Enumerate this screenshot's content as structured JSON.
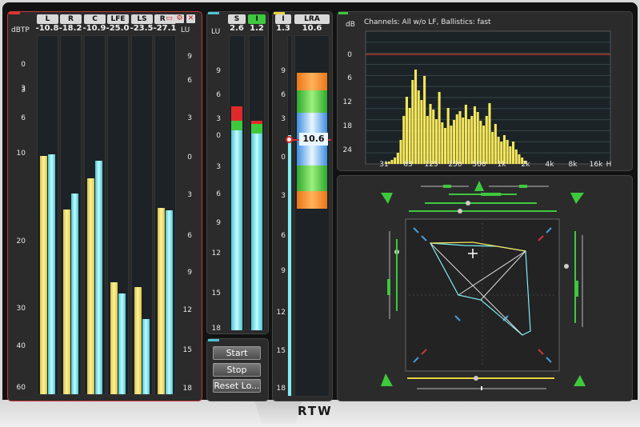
{
  "loudness_panel": {
    "channels": [
      {
        "label": "L",
        "value": "-10.8"
      },
      {
        "label": "R",
        "value": "-18.2"
      },
      {
        "label": "C",
        "value": "-10.9"
      },
      {
        "label": "LFE",
        "value": "-25.0"
      },
      {
        "label": "LS",
        "value": "-23.5"
      },
      {
        "label": "RS",
        "value": "-27.1"
      }
    ],
    "left_unit": "dBTP",
    "right_unit": "LU",
    "left_ticks": [
      "3",
      "0",
      "3",
      "6",
      "10",
      "20",
      "30",
      "40",
      "60"
    ],
    "right_ticks": [
      "9",
      "6",
      "3",
      "0",
      "3",
      "6",
      "9",
      "12",
      "15",
      "18"
    ],
    "icons": {
      "window": "window-icon",
      "settings": "settings-icon",
      "close": "close-icon"
    },
    "close_glyph": "✕"
  },
  "si_panel": {
    "headers": [
      {
        "label": "S",
        "value": "2.6"
      },
      {
        "label": "I",
        "value": "1.2"
      }
    ],
    "unit": "LU",
    "ticks": [
      "9",
      "6",
      "3",
      "0",
      "3",
      "6",
      "9",
      "12",
      "15",
      "18"
    ]
  },
  "controls": {
    "start": "Start",
    "stop": "Stop",
    "reset": "Reset Lo..."
  },
  "lra_panel": {
    "headers": [
      {
        "label": "I",
        "value": "1.3"
      },
      {
        "label": "LRA",
        "value": "10.6"
      }
    ],
    "marker_value": "10.6",
    "ticks": [
      "9",
      "6",
      "3",
      "0",
      "3",
      "6",
      "9",
      "12",
      "15",
      "18"
    ]
  },
  "spectrum_panel": {
    "title": "Channels: All w/o LF, Ballistics: fast",
    "y_unit": "dB",
    "y_ticks": [
      "0",
      "6",
      "12",
      "18",
      "24"
    ],
    "x_ticks": [
      "31",
      "63",
      "125",
      "250",
      "500",
      "1k",
      "2k",
      "4k",
      "8k",
      "16k",
      "H"
    ]
  },
  "colors": {
    "yellow": "#f4e65c",
    "cyan": "#7feef8",
    "red": "#e02a2a",
    "green": "#3ec83e",
    "orange": "#f28a1e"
  }
}
